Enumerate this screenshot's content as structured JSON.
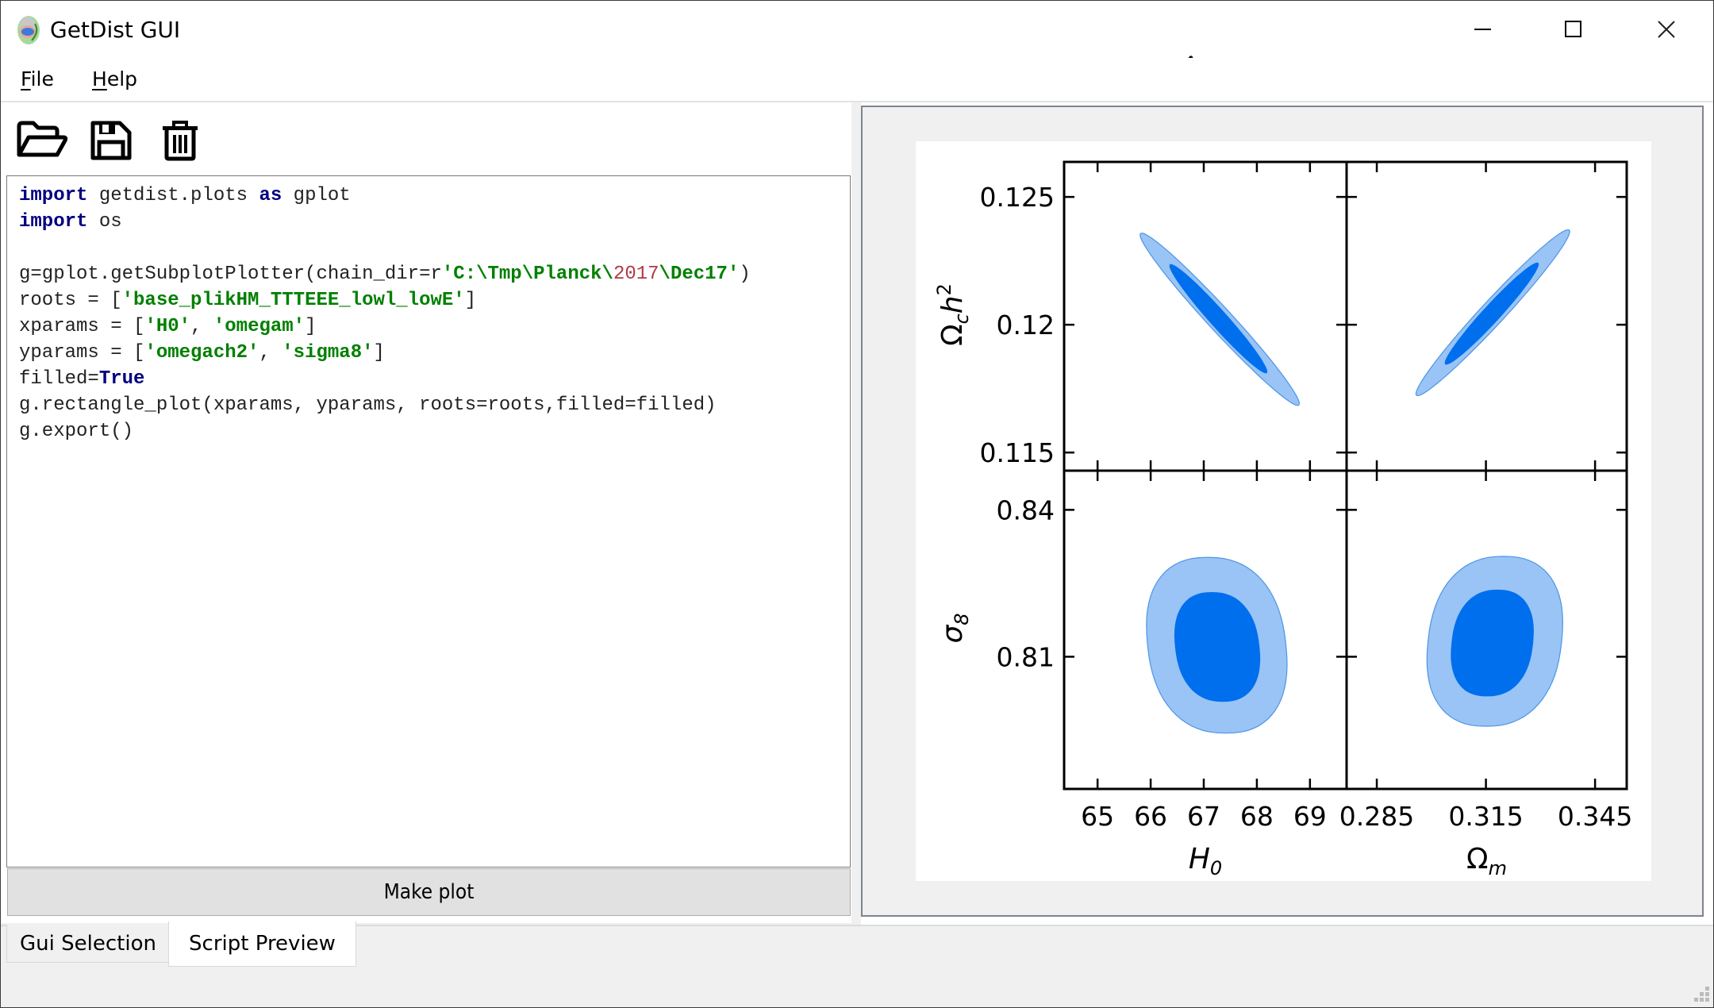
{
  "window": {
    "title": "GetDist GUI",
    "controls": {
      "minimize": "minimize",
      "maximize": "maximize",
      "close": "close"
    }
  },
  "menu": {
    "items": [
      {
        "label_access": "F",
        "label_rest": "ile"
      },
      {
        "label_access": "H",
        "label_rest": "elp"
      }
    ]
  },
  "toolbar": {
    "icons": [
      "open-folder-icon",
      "save-icon",
      "trash-icon"
    ]
  },
  "editor": {
    "lines": [
      [
        {
          "t": "import",
          "c": "kw"
        },
        {
          "t": " getdist.plots ",
          "c": ""
        },
        {
          "t": "as",
          "c": "kw"
        },
        {
          "t": " gplot",
          "c": ""
        }
      ],
      [
        {
          "t": "import",
          "c": "kw"
        },
        {
          "t": " os",
          "c": ""
        }
      ],
      [],
      [
        {
          "t": "g=gplot.getSubplotPlotter(chain_dir=r",
          "c": ""
        },
        {
          "t": "'C:\\Tmp\\Planck\\",
          "c": "str"
        },
        {
          "t": "2017",
          "c": "num"
        },
        {
          "t": "\\Dec17'",
          "c": "str"
        },
        {
          "t": ")",
          "c": ""
        }
      ],
      [
        {
          "t": "roots = [",
          "c": ""
        },
        {
          "t": "'base_plikHM_TTTEEE_lowl_lowE'",
          "c": "str"
        },
        {
          "t": "]",
          "c": ""
        }
      ],
      [
        {
          "t": "xparams = [",
          "c": ""
        },
        {
          "t": "'H0'",
          "c": "str"
        },
        {
          "t": ", ",
          "c": ""
        },
        {
          "t": "'omegam'",
          "c": "str"
        },
        {
          "t": "]",
          "c": ""
        }
      ],
      [
        {
          "t": "yparams = [",
          "c": ""
        },
        {
          "t": "'omegach2'",
          "c": "str"
        },
        {
          "t": ", ",
          "c": ""
        },
        {
          "t": "'sigma8'",
          "c": "str"
        },
        {
          "t": "]",
          "c": ""
        }
      ],
      [
        {
          "t": "filled=",
          "c": ""
        },
        {
          "t": "True",
          "c": "kw"
        }
      ],
      [
        {
          "t": "g.rectangle_plot(xparams, yparams, roots=roots,filled=filled)",
          "c": ""
        }
      ],
      [
        {
          "t": "g.export()",
          "c": ""
        }
      ]
    ]
  },
  "buttons": {
    "make_plot": "Make plot"
  },
  "tabs": [
    {
      "label": "Gui Selection",
      "active": false
    },
    {
      "label": "Script Preview",
      "active": true
    }
  ],
  "colors": {
    "contour_outer": "#99c4f5",
    "contour_inner": "#006fed",
    "contour_edge": "#4d95e6",
    "keyword": "#000080",
    "string": "#008000",
    "number": "#b03a48"
  },
  "chart_data": {
    "type": "contour",
    "title": "",
    "root": "base_plikHM_TTTEEE_lowl_lowE",
    "filled": true,
    "columns": [
      {
        "param": "H0",
        "label": "H",
        "label_sub": "0",
        "range": [
          64.37,
          69.69
        ],
        "ticks": [
          65,
          66,
          67,
          68,
          69
        ],
        "tick_labels": [
          "65",
          "66",
          "67",
          "68",
          "69"
        ]
      },
      {
        "param": "omegam",
        "label": "Ω",
        "label_sub": "m",
        "range": [
          0.2767,
          0.3537
        ],
        "ticks": [
          0.285,
          0.315,
          0.345
        ],
        "tick_labels": [
          "0.285",
          "0.315",
          "0.345"
        ]
      }
    ],
    "rows": [
      {
        "param": "omegach2",
        "label": "Ω",
        "label_sub": "c",
        "label_tail": "h",
        "label_sup": "2",
        "range": [
          0.11429,
          0.12637
        ],
        "ticks": [
          0.115,
          0.12,
          0.125
        ],
        "tick_labels": [
          "0.115",
          "0.12",
          "0.125"
        ]
      },
      {
        "param": "sigma8",
        "label": "σ",
        "label_sub": "8",
        "range": [
          0.783,
          0.848
        ],
        "ticks": [
          0.81,
          0.84
        ],
        "tick_labels": [
          "0.81",
          "0.84"
        ]
      }
    ],
    "panels": [
      {
        "row": 0,
        "col": 0,
        "shape": "ellipse",
        "correlation": "negative",
        "outer": {
          "x": [
            65.81,
            68.79
          ],
          "y": [
            0.11686,
            0.12357
          ]
        },
        "inner": {
          "x": [
            66.36,
            68.19
          ],
          "y": [
            0.11811,
            0.12236
          ]
        }
      },
      {
        "row": 0,
        "col": 1,
        "shape": "ellipse",
        "correlation": "positive",
        "outer": {
          "x": [
            0.2959,
            0.3379
          ],
          "y": [
            0.11724,
            0.1237
          ]
        },
        "inner": {
          "x": [
            0.3038,
            0.3294
          ],
          "y": [
            0.11845,
            0.12242
          ]
        }
      },
      {
        "row": 1,
        "col": 0,
        "shape": "blob",
        "correlation": "negative",
        "outer": {
          "x": [
            65.73,
            68.76
          ],
          "y": [
            0.7944,
            0.8303
          ]
        },
        "inner": {
          "x": [
            66.33,
            68.18
          ],
          "y": [
            0.8008,
            0.8232
          ]
        }
      },
      {
        "row": 1,
        "col": 1,
        "shape": "blob",
        "correlation": "positive",
        "outer": {
          "x": [
            0.2961,
            0.3388
          ],
          "y": [
            0.7958,
            0.8305
          ]
        },
        "inner": {
          "x": [
            0.3037,
            0.3298
          ],
          "y": [
            0.8019,
            0.8237
          ]
        }
      }
    ],
    "grid": false,
    "legend": "none"
  }
}
